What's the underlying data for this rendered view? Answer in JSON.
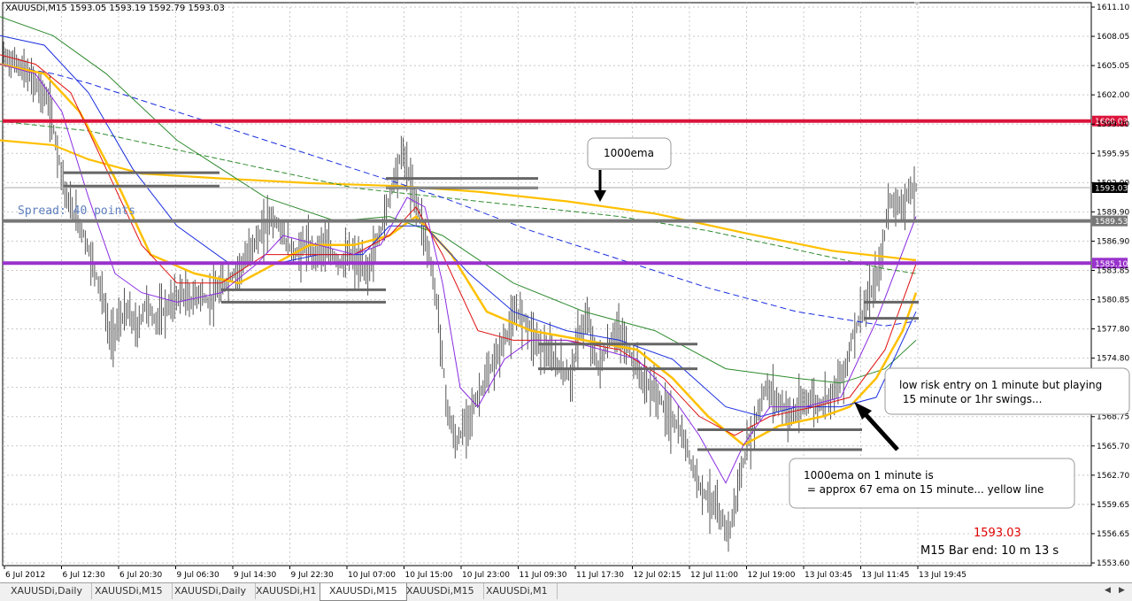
{
  "chart_data": {
    "type": "candlestick",
    "symbol_header": "XAUUSDi,M15  1593.05 1593.19 1592.79 1593.03",
    "ylim": [
      1553.6,
      1612.0
    ],
    "y_ticks": [
      "1611.10",
      "1608.05",
      "1605.05",
      "1602.00",
      "1599.00",
      "1595.95",
      "1592.90",
      "1589.90",
      "1586.90",
      "1583.85",
      "1580.85",
      "1577.80",
      "1574.80",
      "1571.75",
      "1568.75",
      "1565.70",
      "1562.70",
      "1559.65",
      "1556.65",
      "1553.60"
    ],
    "x_ticks": [
      "6 Jul 2012",
      "6 Jul 12:30",
      "6 Jul 20:30",
      "9 Jul 06:30",
      "9 Jul 14:30",
      "9 Jul 22:30",
      "10 Jul 07:00",
      "10 Jul 15:00",
      "10 Jul 23:00",
      "11 Jul 09:30",
      "11 Jul 17:30",
      "12 Jul 02:15",
      "12 Jul 11:00",
      "12 Jul 19:00",
      "13 Jul 03:45",
      "13 Jul 11:45",
      "13 Jul 19:45"
    ],
    "close_path": [
      [
        0,
        1607
      ],
      [
        20,
        1606
      ],
      [
        40,
        1604
      ],
      [
        55,
        1602
      ],
      [
        65,
        1597
      ],
      [
        75,
        1592
      ],
      [
        85,
        1590
      ],
      [
        95,
        1588
      ],
      [
        105,
        1585
      ],
      [
        115,
        1582
      ],
      [
        125,
        1577
      ],
      [
        135,
        1579
      ],
      [
        145,
        1580
      ],
      [
        155,
        1578
      ],
      [
        165,
        1581
      ],
      [
        175,
        1579
      ],
      [
        185,
        1580
      ],
      [
        195,
        1581
      ],
      [
        205,
        1582
      ],
      [
        215,
        1581
      ],
      [
        225,
        1582
      ],
      [
        235,
        1581
      ],
      [
        245,
        1582
      ],
      [
        255,
        1583
      ],
      [
        265,
        1584
      ],
      [
        275,
        1585
      ],
      [
        285,
        1587
      ],
      [
        295,
        1588
      ],
      [
        305,
        1590
      ],
      [
        315,
        1589
      ],
      [
        325,
        1587
      ],
      [
        335,
        1586
      ],
      [
        345,
        1587
      ],
      [
        355,
        1586
      ],
      [
        365,
        1587
      ],
      [
        375,
        1586
      ],
      [
        385,
        1585
      ],
      [
        395,
        1586
      ],
      [
        405,
        1585
      ],
      [
        415,
        1584
      ],
      [
        425,
        1587
      ],
      [
        435,
        1590
      ],
      [
        445,
        1594
      ],
      [
        455,
        1597
      ],
      [
        465,
        1593
      ],
      [
        475,
        1590
      ],
      [
        485,
        1586
      ],
      [
        495,
        1580
      ],
      [
        505,
        1570
      ],
      [
        515,
        1566
      ],
      [
        525,
        1568
      ],
      [
        535,
        1570
      ],
      [
        545,
        1572
      ],
      [
        555,
        1574
      ],
      [
        565,
        1576
      ],
      [
        575,
        1578
      ],
      [
        585,
        1580
      ],
      [
        595,
        1579
      ],
      [
        605,
        1577
      ],
      [
        615,
        1576
      ],
      [
        625,
        1575
      ],
      [
        635,
        1574
      ],
      [
        645,
        1573
      ],
      [
        655,
        1578
      ],
      [
        665,
        1579
      ],
      [
        675,
        1574
      ],
      [
        685,
        1576
      ],
      [
        695,
        1578
      ],
      [
        705,
        1577
      ],
      [
        715,
        1575
      ],
      [
        725,
        1573
      ],
      [
        735,
        1572
      ],
      [
        745,
        1571
      ],
      [
        755,
        1569
      ],
      [
        765,
        1568
      ],
      [
        775,
        1566
      ],
      [
        785,
        1563
      ],
      [
        795,
        1561
      ],
      [
        805,
        1560
      ],
      [
        815,
        1558
      ],
      [
        825,
        1557
      ],
      [
        835,
        1562
      ],
      [
        845,
        1566
      ],
      [
        855,
        1569
      ],
      [
        865,
        1572
      ],
      [
        875,
        1571
      ],
      [
        885,
        1570
      ],
      [
        895,
        1569
      ],
      [
        905,
        1570
      ],
      [
        915,
        1571
      ],
      [
        925,
        1570
      ],
      [
        935,
        1571
      ],
      [
        945,
        1572
      ],
      [
        955,
        1574
      ],
      [
        965,
        1578
      ],
      [
        975,
        1580
      ],
      [
        985,
        1582
      ],
      [
        995,
        1585
      ],
      [
        1005,
        1592
      ],
      [
        1015,
        1591
      ],
      [
        1025,
        1592
      ],
      [
        1035,
        1593
      ]
    ],
    "ema_lines": [
      {
        "color": "#ffc000",
        "width": 2.2,
        "dash": "",
        "pts": [
          [
            0,
            1598
          ],
          [
            60,
            1597.5
          ],
          [
            100,
            1596
          ],
          [
            160,
            1594.5
          ],
          [
            250,
            1594
          ],
          [
            350,
            1593.5
          ],
          [
            450,
            1593.2
          ],
          [
            540,
            1592.6
          ],
          [
            640,
            1591.6
          ],
          [
            740,
            1590.3
          ],
          [
            840,
            1588.3
          ],
          [
            940,
            1586.4
          ],
          [
            1035,
            1585.4
          ]
        ]
      },
      {
        "color": "#2e8b2e",
        "width": 1,
        "dash": "6,3",
        "pts": [
          [
            0,
            1600
          ],
          [
            100,
            1599
          ],
          [
            200,
            1597
          ],
          [
            300,
            1595
          ],
          [
            400,
            1593
          ],
          [
            500,
            1592
          ],
          [
            600,
            1591
          ],
          [
            700,
            1590
          ],
          [
            800,
            1588.5
          ],
          [
            900,
            1586.5
          ],
          [
            1000,
            1584.5
          ],
          [
            1035,
            1584
          ]
        ]
      },
      {
        "color": "#1a2ee0",
        "width": 1,
        "dash": "7,4",
        "pts": [
          [
            0,
            1606
          ],
          [
            60,
            1605
          ],
          [
            100,
            1604
          ],
          [
            200,
            1601
          ],
          [
            300,
            1598
          ],
          [
            400,
            1595
          ],
          [
            500,
            1592
          ],
          [
            600,
            1588.5
          ],
          [
            700,
            1585.5
          ],
          [
            800,
            1582.5
          ],
          [
            900,
            1580
          ],
          [
            1000,
            1578.5
          ],
          [
            1035,
            1579
          ]
        ]
      },
      {
        "color": "#2e8b2e",
        "width": 1,
        "dash": "",
        "pts": [
          [
            0,
            1611
          ],
          [
            60,
            1609
          ],
          [
            120,
            1605
          ],
          [
            200,
            1598
          ],
          [
            300,
            1592
          ],
          [
            380,
            1589.5
          ],
          [
            440,
            1590
          ],
          [
            500,
            1588
          ],
          [
            580,
            1583
          ],
          [
            660,
            1580
          ],
          [
            740,
            1578
          ],
          [
            820,
            1574
          ],
          [
            900,
            1573
          ],
          [
            950,
            1572.5
          ],
          [
            1000,
            1574
          ],
          [
            1035,
            1577
          ]
        ]
      },
      {
        "color": "#ffc000",
        "width": 2.5,
        "dash": "",
        "pts": [
          [
            0,
            1606
          ],
          [
            50,
            1605
          ],
          [
            90,
            1601
          ],
          [
            130,
            1594
          ],
          [
            170,
            1586
          ],
          [
            220,
            1584
          ],
          [
            270,
            1583
          ],
          [
            310,
            1585
          ],
          [
            350,
            1587
          ],
          [
            400,
            1587
          ],
          [
            440,
            1588
          ],
          [
            470,
            1590
          ],
          [
            510,
            1586
          ],
          [
            550,
            1580
          ],
          [
            600,
            1578
          ],
          [
            660,
            1577
          ],
          [
            720,
            1576
          ],
          [
            760,
            1573
          ],
          [
            800,
            1569
          ],
          [
            840,
            1566
          ],
          [
            880,
            1568
          ],
          [
            930,
            1569
          ],
          [
            960,
            1570
          ],
          [
            990,
            1573
          ],
          [
            1020,
            1578
          ],
          [
            1035,
            1582
          ]
        ]
      },
      {
        "color": "#1a2ee0",
        "width": 1,
        "dash": "",
        "pts": [
          [
            0,
            1609
          ],
          [
            50,
            1608
          ],
          [
            100,
            1603
          ],
          [
            150,
            1595
          ],
          [
            200,
            1589
          ],
          [
            260,
            1585
          ],
          [
            310,
            1585
          ],
          [
            360,
            1586
          ],
          [
            410,
            1586
          ],
          [
            440,
            1589
          ],
          [
            480,
            1589
          ],
          [
            530,
            1584
          ],
          [
            580,
            1580
          ],
          [
            640,
            1578
          ],
          [
            700,
            1577
          ],
          [
            760,
            1575
          ],
          [
            820,
            1570
          ],
          [
            860,
            1569
          ],
          [
            900,
            1570
          ],
          [
            950,
            1570
          ],
          [
            990,
            1571
          ],
          [
            1035,
            1580
          ]
        ]
      },
      {
        "color": "#e01010",
        "width": 1,
        "dash": "",
        "pts": [
          [
            0,
            1607
          ],
          [
            40,
            1606
          ],
          [
            80,
            1603
          ],
          [
            120,
            1595
          ],
          [
            160,
            1587
          ],
          [
            200,
            1583
          ],
          [
            250,
            1583
          ],
          [
            300,
            1586
          ],
          [
            350,
            1586
          ],
          [
            400,
            1586
          ],
          [
            440,
            1588
          ],
          [
            470,
            1591
          ],
          [
            500,
            1586
          ],
          [
            540,
            1578
          ],
          [
            580,
            1577
          ],
          [
            640,
            1577
          ],
          [
            700,
            1576
          ],
          [
            750,
            1573
          ],
          [
            790,
            1569
          ],
          [
            830,
            1567
          ],
          [
            870,
            1569
          ],
          [
            920,
            1570
          ],
          [
            960,
            1571
          ],
          [
            1000,
            1576
          ],
          [
            1035,
            1585
          ]
        ]
      },
      {
        "color": "#8a2be2",
        "width": 1,
        "dash": "",
        "pts": [
          [
            0,
            1606
          ],
          [
            40,
            1605
          ],
          [
            70,
            1601
          ],
          [
            100,
            1592
          ],
          [
            130,
            1584
          ],
          [
            160,
            1582
          ],
          [
            200,
            1581
          ],
          [
            250,
            1582
          ],
          [
            290,
            1585
          ],
          [
            320,
            1588
          ],
          [
            360,
            1587
          ],
          [
            400,
            1586
          ],
          [
            430,
            1587
          ],
          [
            460,
            1592
          ],
          [
            480,
            1591
          ],
          [
            500,
            1583
          ],
          [
            520,
            1572
          ],
          [
            540,
            1570
          ],
          [
            570,
            1575
          ],
          [
            600,
            1577
          ],
          [
            640,
            1577
          ],
          [
            680,
            1576
          ],
          [
            720,
            1575
          ],
          [
            760,
            1571
          ],
          [
            790,
            1567
          ],
          [
            820,
            1562
          ],
          [
            840,
            1566
          ],
          [
            870,
            1570
          ],
          [
            910,
            1570
          ],
          [
            950,
            1571
          ],
          [
            990,
            1579
          ],
          [
            1035,
            1590
          ]
        ]
      }
    ],
    "hlines": [
      {
        "value": 1600.03,
        "label": "1600.03",
        "color": "#dc143c",
        "width": 4
      },
      {
        "value": 1589.53,
        "label": "1589.53",
        "color": "#777777",
        "width": 4
      },
      {
        "value": 1585.1,
        "label": "1585.10",
        "color": "#9932cc",
        "width": 4
      }
    ],
    "bid_line": {
      "value": 1593.03,
      "label": "1593.03"
    },
    "sr_segments": [
      {
        "x1": 72,
        "x2": 248,
        "v": 1594.6
      },
      {
        "x1": 72,
        "x2": 248,
        "v": 1593.2
      },
      {
        "x1": 250,
        "x2": 436,
        "v": 1582.3
      },
      {
        "x1": 250,
        "x2": 436,
        "v": 1581.0
      },
      {
        "x1": 436,
        "x2": 608,
        "v": 1594.0
      },
      {
        "x1": 436,
        "x2": 608,
        "v": 1593.0
      },
      {
        "x1": 608,
        "x2": 788,
        "v": 1576.6
      },
      {
        "x1": 608,
        "x2": 788,
        "v": 1574.0
      },
      {
        "x1": 788,
        "x2": 974,
        "v": 1567.6
      },
      {
        "x1": 788,
        "x2": 974,
        "v": 1565.5
      },
      {
        "x1": 976,
        "x2": 1038,
        "v": 1581.0
      },
      {
        "x1": 976,
        "x2": 1038,
        "v": 1579.3
      }
    ],
    "annotations": [
      {
        "text": "1000ema"
      },
      {
        "text": "low risk entry on 1 minute but playing\n 15 minute or 1hr swings..."
      },
      {
        "text": "1000ema on 1 minute is\n   = approx 67 ema on 15 minute... yellow line"
      }
    ],
    "spread_label": "Spread: 40 points",
    "price_label": "1593.03",
    "bar_end_label": "M15 Bar end: 10 m 13 s",
    "grid": true,
    "colors": {
      "grid": "#c8c8c8",
      "candles": "#555555",
      "spread": "#5f7fbf",
      "price": "#e00000"
    }
  },
  "tabs": [
    {
      "label": "XAUUSDi,Daily",
      "active": false
    },
    {
      "label": "XAUUSDi,M15",
      "active": false
    },
    {
      "label": "XAUUSDi,Daily",
      "active": false
    },
    {
      "label": "XAUUSDi,H1",
      "active": false
    },
    {
      "label": "XAUUSDi,M15",
      "active": true
    },
    {
      "label": "XAUUSDi,M15",
      "active": false
    },
    {
      "label": "XAUUSDi,M1",
      "active": false
    }
  ]
}
